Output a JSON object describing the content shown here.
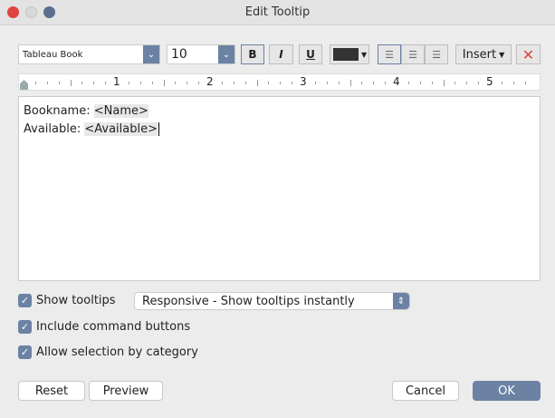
{
  "window": {
    "title": "Edit Tooltip"
  },
  "toolbar": {
    "font": "Tableau Book",
    "size": "10",
    "bold": "B",
    "italic": "I",
    "underline": "U",
    "text_color": "#333333",
    "insert_label": "Insert",
    "clear_icon": "x-icon"
  },
  "ruler": {
    "labels": [
      "1",
      "2",
      "3",
      "4",
      "5"
    ]
  },
  "editor": {
    "lines": [
      {
        "label": "Bookname: ",
        "field": "<Name>"
      },
      {
        "label": "Available: ",
        "field": "<Available>"
      }
    ]
  },
  "options": {
    "show_tooltips": {
      "label": "Show tooltips",
      "checked": true
    },
    "tooltip_mode": "Responsive - Show tooltips instantly",
    "include_command": {
      "label": "Include command buttons",
      "checked": true
    },
    "allow_selection": {
      "label": "Allow selection by category",
      "checked": true
    }
  },
  "buttons": {
    "reset": "Reset",
    "preview": "Preview",
    "cancel": "Cancel",
    "ok": "OK"
  },
  "colors": {
    "accent": "#6b82a3",
    "close": "#e0443e"
  }
}
